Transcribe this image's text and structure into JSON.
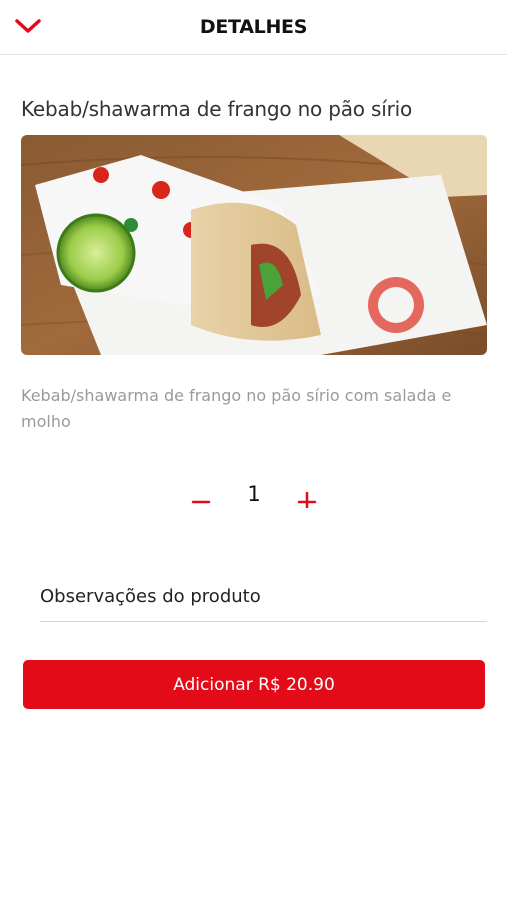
{
  "header": {
    "title": "DETALHES",
    "back_icon": "chevron-down-icon"
  },
  "product": {
    "name": "Kebab/shawarma de frango no pão sírio",
    "image_alt": "kebab-wrap-photo",
    "description": "Kebab/shawarma de frango no pão sírio com salada e molho"
  },
  "quantity": {
    "minus_icon": "minus-icon",
    "value": "1",
    "plus_icon": "plus-icon"
  },
  "notes": {
    "placeholder": "Observações do produto",
    "value": ""
  },
  "add_button": {
    "label": "Adicionar R$ 20.90"
  },
  "colors": {
    "accent": "#e30b17",
    "text": "#222222",
    "muted": "#9a9a9a"
  }
}
